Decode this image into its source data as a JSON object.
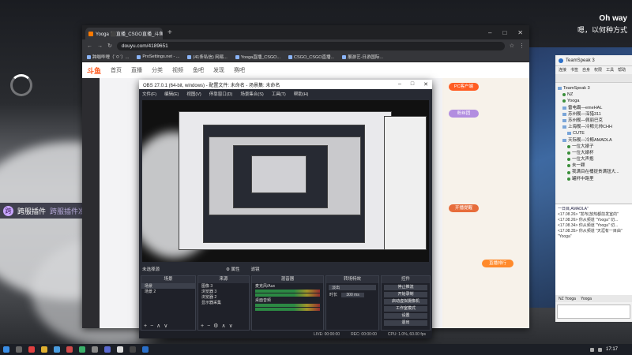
{
  "stream": {
    "caption_title": "Oh way",
    "caption_sub": "嗯，以何种方式",
    "plugin_badge": "跨",
    "plugin_name": "跨服插件",
    "plugin_msg": "跨服插件准备就绪！"
  },
  "browser": {
    "tab_title": "Yooga ⬛直播_CSGO直播_斗鱼 X",
    "url": "douyu.com/4189651",
    "bookmarks": [
      "跨咖哔哩（`ㅇ`）...",
      "ProSettings.net - ...",
      "(41条私信) 网易...",
      "Yooga直播_CSGO...",
      "CSGO_CSGO直播...",
      "展游艺-日游国际..."
    ],
    "site_nav": [
      "首页",
      "直播",
      "分类",
      "视频",
      "鱼吧",
      "发现",
      "赛吧"
    ],
    "site_logo": "斗鱼",
    "pills": [
      "PC客户端",
      "粉丝团",
      "开播提醒",
      "直播排行"
    ]
  },
  "obs": {
    "title": "OBS 27.0.1 (64-bit, windows) - 配置文件: 未命名 - 场景集: 未命名",
    "menu": [
      "文件(F)",
      "编辑(E)",
      "视图(V)",
      "停靠窗口(D)",
      "场景集合(S)",
      "工具(T)",
      "帮助(H)"
    ],
    "no_source": "未选择源",
    "transport": [
      "⚙ 属性",
      "滤镜"
    ],
    "docks": {
      "scenes": {
        "header": "场景",
        "rows": [
          "场景",
          "场景 2"
        ]
      },
      "sources": {
        "header": "来源",
        "rows": [
          "图像 3",
          "浏览器 3",
          "浏览器 2",
          "显示器采集"
        ]
      },
      "mixer": {
        "header": "混音器",
        "rows": [
          "麦克风/Aux",
          "桌面音频"
        ]
      },
      "transitions": {
        "header": "转场特效",
        "type": "淡出",
        "duration_label": "时长",
        "duration": "300 ms"
      },
      "controls": {
        "header": "控件",
        "buttons": [
          "停止推流",
          "开始录制",
          "启动虚拟摄像机",
          "工作室模式",
          "设置",
          "退出"
        ]
      }
    },
    "status": [
      "LIVE: 00:00:00",
      "REC: 00:00:00",
      "CPU: 1.0%, 60.00 fps"
    ]
  },
  "teamspeak": {
    "title": "TeamSpeak 3",
    "menu": [
      "连接",
      "书签",
      "自身",
      "权限",
      "工具",
      "帮助"
    ],
    "tree": [
      {
        "label": "TeamSpeak 3",
        "kind": "server"
      },
      {
        "label": "NZ",
        "kind": "user"
      },
      {
        "label": "Yooga",
        "kind": "user"
      },
      {
        "label": "雷电霸—emeHAL",
        "kind": "channel"
      },
      {
        "label": "苏州舰—深猎311",
        "kind": "channel"
      },
      {
        "label": "苏州舰—佩丽巴克",
        "kind": "channel"
      },
      {
        "label": "上海舰—冷鲸元帅CHH",
        "kind": "channel"
      },
      {
        "label": "CUTE",
        "kind": "channel"
      },
      {
        "label": "天际舰—冷鲸AMADLA",
        "kind": "channel"
      },
      {
        "label": "一位大婊子",
        "kind": "user"
      },
      {
        "label": "一位大婊杯",
        "kind": "user"
      },
      {
        "label": "一位大声抱",
        "kind": "user"
      },
      {
        "label": "未一颗",
        "kind": "user"
      },
      {
        "label": "我满目在桶提贵满钮大...",
        "kind": "user"
      },
      {
        "label": "罐杯中路里",
        "kind": "user"
      }
    ],
    "chat": [
      "一日目,AMADLA\"",
      "<17.08.26> \"发布(放热都前发室的\"",
      "<17.08.26> 你从频道 \"Yooga\" 切...",
      "<17.08.34> 你从频道 \"Yooga\" 切...",
      "<17.08.35> 你从频道 \"天涯有一目由\"",
      "\"Yooga\""
    ],
    "chat_tabs": [
      "NZ Yooga",
      "Yooga"
    ]
  },
  "taskbar": {
    "clock": "17:17"
  },
  "colors": {
    "accent_douyu": "#ff5d23",
    "obs_bg": "#272a33",
    "meter_green": "#2fa34a"
  }
}
